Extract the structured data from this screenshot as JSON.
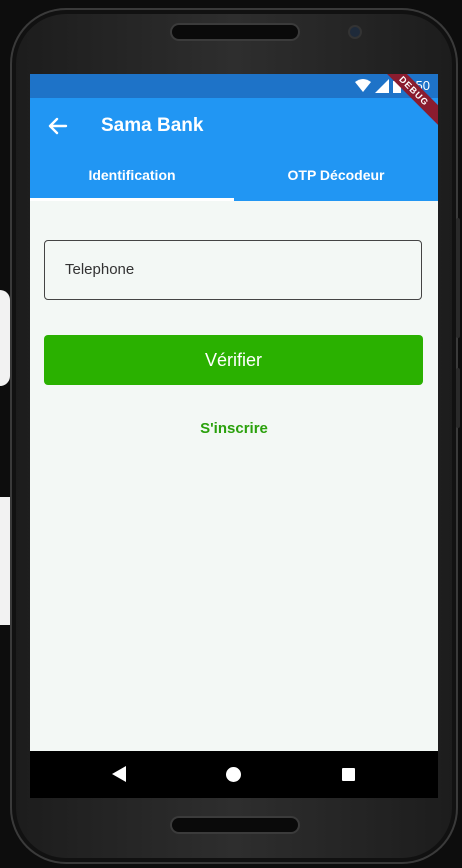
{
  "status_bar": {
    "time": "9:50"
  },
  "app_bar": {
    "title": "Sama Bank"
  },
  "debug_banner": "DEBUG",
  "tabs": [
    {
      "label": "Identification",
      "active": true
    },
    {
      "label": "OTP Décodeur",
      "active": false
    }
  ],
  "form": {
    "phone_placeholder": "Telephone",
    "verify_label": "Vérifier",
    "signup_label": "S'inscrire"
  },
  "colors": {
    "primary": "#2196f3",
    "status_bar": "#1e73c8",
    "button": "#2ab100",
    "link": "#2aa10c",
    "background": "#f3f8f5"
  },
  "icons": [
    "back-arrow-icon",
    "wifi-icon",
    "signal-icon",
    "battery-icon",
    "nav-back-icon",
    "nav-home-icon",
    "nav-recents-icon"
  ]
}
